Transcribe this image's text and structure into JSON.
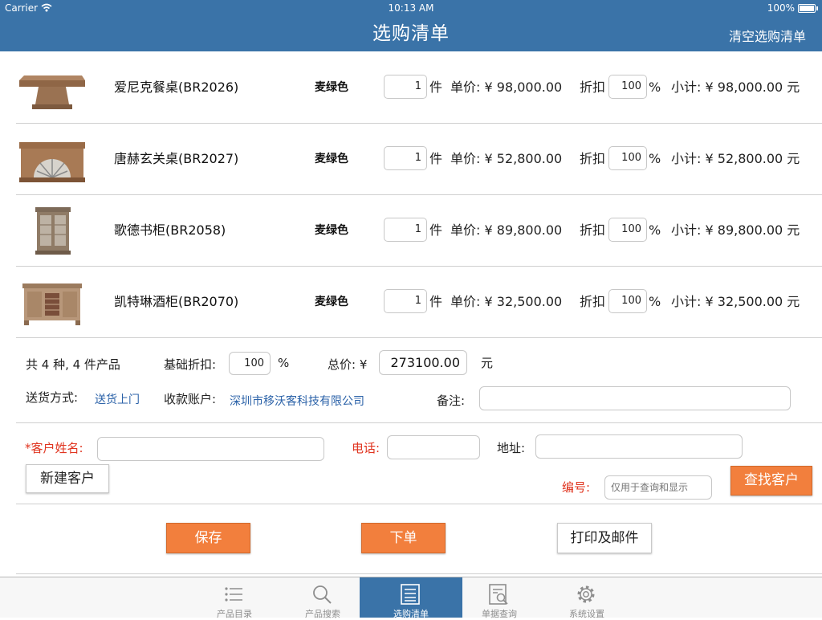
{
  "status": {
    "carrier": "Carrier",
    "time": "10:13 AM",
    "battery": "100%"
  },
  "nav": {
    "title": "选购清单",
    "clear_label": "清空选购清单"
  },
  "labels": {
    "unit": "件",
    "price": "单价:",
    "discount": "折扣",
    "percent": "%",
    "subtotal": "小计:"
  },
  "items": [
    {
      "name": "爱尼克餐桌(BR2026)",
      "color": "麦绿色",
      "qty": "1",
      "price": "¥ 98,000.00",
      "discount": "100",
      "subtotal": "¥ 98,000.00 元"
    },
    {
      "name": "唐赫玄关桌(BR2027)",
      "color": "麦绿色",
      "qty": "1",
      "price": "¥ 52,800.00",
      "discount": "100",
      "subtotal": "¥ 52,800.00 元"
    },
    {
      "name": "歌德书柜(BR2058)",
      "color": "麦绿色",
      "qty": "1",
      "price": "¥ 89,800.00",
      "discount": "100",
      "subtotal": "¥ 89,800.00 元"
    },
    {
      "name": "凯特琳酒柜(BR2070)",
      "color": "麦绿色",
      "qty": "1",
      "price": "¥ 32,500.00",
      "discount": "100",
      "subtotal": "¥ 32,500.00 元"
    }
  ],
  "summary": {
    "count_text": "共 4 种, 4 件产品",
    "base_discount_label": "基础折扣:",
    "base_discount_value": "100",
    "percent": "%",
    "total_label": "总价: ¥",
    "total_value": "273100.00",
    "total_unit": "元",
    "delivery_label": "送货方式:",
    "delivery_value": "送货上门",
    "account_label": "收款账户:",
    "account_value": "深圳市移沃客科技有限公司",
    "remark_label": "备注:",
    "remark_value": ""
  },
  "customer": {
    "name_label": "*客户姓名:",
    "name_value": "",
    "phone_label": "电话:",
    "phone_value": "",
    "address_label": "地址:",
    "address_value": "",
    "new_customer_button": "新建客户",
    "code_label": "编号:",
    "code_placeholder": "仅用于查询和显示",
    "find_customer_button": "查找客户"
  },
  "actions": {
    "save": "保存",
    "order": "下单",
    "print_email": "打印及邮件"
  },
  "tabs": [
    {
      "label": "产品目录",
      "icon": "list-icon"
    },
    {
      "label": "产品搜索",
      "icon": "search-icon"
    },
    {
      "label": "选购清单",
      "icon": "document-icon",
      "active": true
    },
    {
      "label": "单据查询",
      "icon": "document-search-icon"
    },
    {
      "label": "系统设置",
      "icon": "gear-icon"
    }
  ],
  "colors": {
    "nav_blue": "#3a73a8",
    "accent_orange": "#f27f3d",
    "required_red": "#e0341f",
    "link_blue": "#2b62a8"
  }
}
